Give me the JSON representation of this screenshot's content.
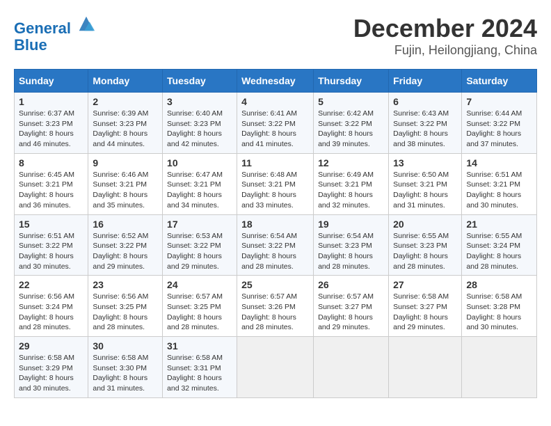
{
  "header": {
    "logo_line1": "General",
    "logo_line2": "Blue",
    "title": "December 2024",
    "subtitle": "Fujin, Heilongjiang, China"
  },
  "calendar": {
    "days_of_week": [
      "Sunday",
      "Monday",
      "Tuesday",
      "Wednesday",
      "Thursday",
      "Friday",
      "Saturday"
    ],
    "weeks": [
      [
        {
          "day": "1",
          "sunrise": "6:37 AM",
          "sunset": "3:23 PM",
          "daylight": "8 hours and 46 minutes."
        },
        {
          "day": "2",
          "sunrise": "6:39 AM",
          "sunset": "3:23 PM",
          "daylight": "8 hours and 44 minutes."
        },
        {
          "day": "3",
          "sunrise": "6:40 AM",
          "sunset": "3:23 PM",
          "daylight": "8 hours and 42 minutes."
        },
        {
          "day": "4",
          "sunrise": "6:41 AM",
          "sunset": "3:22 PM",
          "daylight": "8 hours and 41 minutes."
        },
        {
          "day": "5",
          "sunrise": "6:42 AM",
          "sunset": "3:22 PM",
          "daylight": "8 hours and 39 minutes."
        },
        {
          "day": "6",
          "sunrise": "6:43 AM",
          "sunset": "3:22 PM",
          "daylight": "8 hours and 38 minutes."
        },
        {
          "day": "7",
          "sunrise": "6:44 AM",
          "sunset": "3:22 PM",
          "daylight": "8 hours and 37 minutes."
        }
      ],
      [
        {
          "day": "8",
          "sunrise": "6:45 AM",
          "sunset": "3:21 PM",
          "daylight": "8 hours and 36 minutes."
        },
        {
          "day": "9",
          "sunrise": "6:46 AM",
          "sunset": "3:21 PM",
          "daylight": "8 hours and 35 minutes."
        },
        {
          "day": "10",
          "sunrise": "6:47 AM",
          "sunset": "3:21 PM",
          "daylight": "8 hours and 34 minutes."
        },
        {
          "day": "11",
          "sunrise": "6:48 AM",
          "sunset": "3:21 PM",
          "daylight": "8 hours and 33 minutes."
        },
        {
          "day": "12",
          "sunrise": "6:49 AM",
          "sunset": "3:21 PM",
          "daylight": "8 hours and 32 minutes."
        },
        {
          "day": "13",
          "sunrise": "6:50 AM",
          "sunset": "3:21 PM",
          "daylight": "8 hours and 31 minutes."
        },
        {
          "day": "14",
          "sunrise": "6:51 AM",
          "sunset": "3:21 PM",
          "daylight": "8 hours and 30 minutes."
        }
      ],
      [
        {
          "day": "15",
          "sunrise": "6:51 AM",
          "sunset": "3:22 PM",
          "daylight": "8 hours and 30 minutes."
        },
        {
          "day": "16",
          "sunrise": "6:52 AM",
          "sunset": "3:22 PM",
          "daylight": "8 hours and 29 minutes."
        },
        {
          "day": "17",
          "sunrise": "6:53 AM",
          "sunset": "3:22 PM",
          "daylight": "8 hours and 29 minutes."
        },
        {
          "day": "18",
          "sunrise": "6:54 AM",
          "sunset": "3:22 PM",
          "daylight": "8 hours and 28 minutes."
        },
        {
          "day": "19",
          "sunrise": "6:54 AM",
          "sunset": "3:23 PM",
          "daylight": "8 hours and 28 minutes."
        },
        {
          "day": "20",
          "sunrise": "6:55 AM",
          "sunset": "3:23 PM",
          "daylight": "8 hours and 28 minutes."
        },
        {
          "day": "21",
          "sunrise": "6:55 AM",
          "sunset": "3:24 PM",
          "daylight": "8 hours and 28 minutes."
        }
      ],
      [
        {
          "day": "22",
          "sunrise": "6:56 AM",
          "sunset": "3:24 PM",
          "daylight": "8 hours and 28 minutes."
        },
        {
          "day": "23",
          "sunrise": "6:56 AM",
          "sunset": "3:25 PM",
          "daylight": "8 hours and 28 minutes."
        },
        {
          "day": "24",
          "sunrise": "6:57 AM",
          "sunset": "3:25 PM",
          "daylight": "8 hours and 28 minutes."
        },
        {
          "day": "25",
          "sunrise": "6:57 AM",
          "sunset": "3:26 PM",
          "daylight": "8 hours and 28 minutes."
        },
        {
          "day": "26",
          "sunrise": "6:57 AM",
          "sunset": "3:27 PM",
          "daylight": "8 hours and 29 minutes."
        },
        {
          "day": "27",
          "sunrise": "6:58 AM",
          "sunset": "3:27 PM",
          "daylight": "8 hours and 29 minutes."
        },
        {
          "day": "28",
          "sunrise": "6:58 AM",
          "sunset": "3:28 PM",
          "daylight": "8 hours and 30 minutes."
        }
      ],
      [
        {
          "day": "29",
          "sunrise": "6:58 AM",
          "sunset": "3:29 PM",
          "daylight": "8 hours and 30 minutes."
        },
        {
          "day": "30",
          "sunrise": "6:58 AM",
          "sunset": "3:30 PM",
          "daylight": "8 hours and 31 minutes."
        },
        {
          "day": "31",
          "sunrise": "6:58 AM",
          "sunset": "3:31 PM",
          "daylight": "8 hours and 32 minutes."
        },
        null,
        null,
        null,
        null
      ]
    ]
  }
}
